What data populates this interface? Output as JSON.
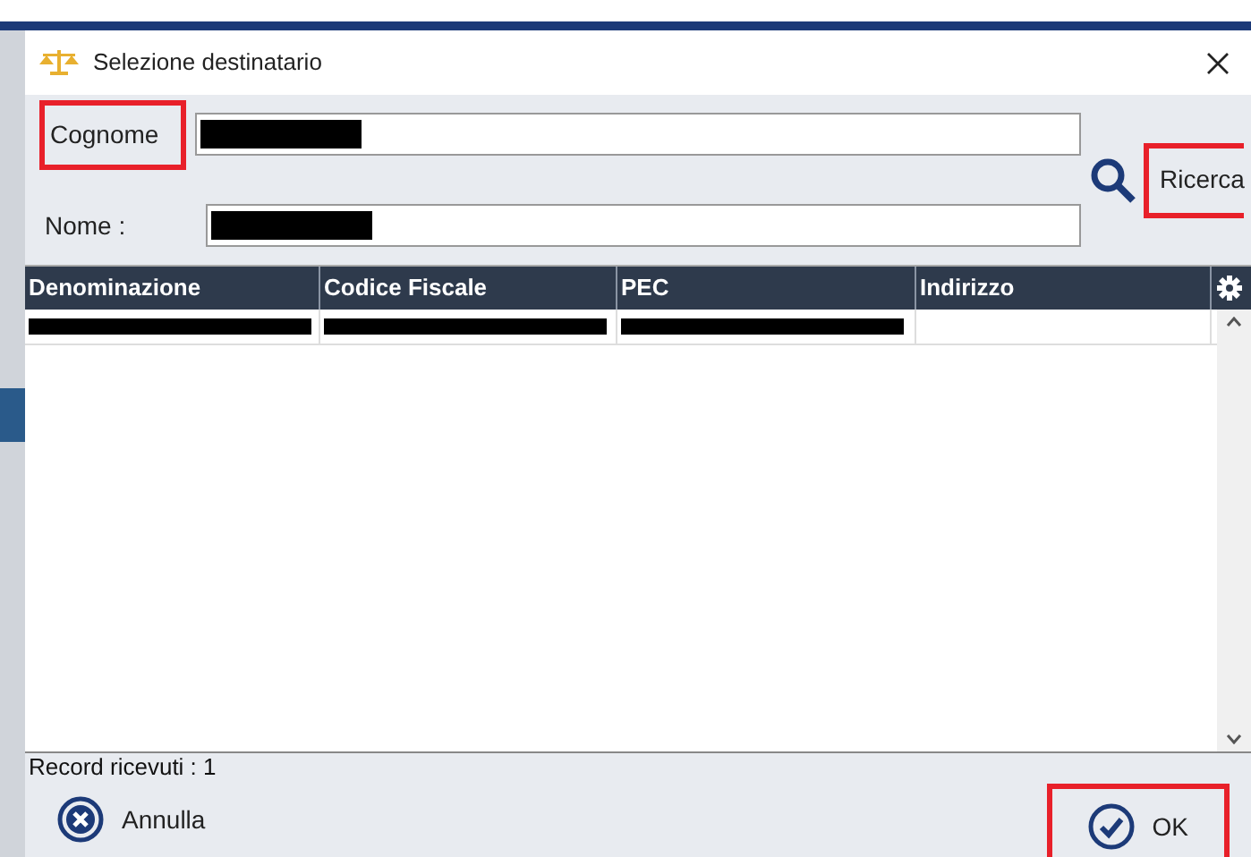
{
  "window": {
    "title": "Selezione destinatario"
  },
  "fields": [
    {
      "label": "Cognome",
      "redacted": true,
      "highlighted": true
    },
    {
      "label": "Nome :",
      "redacted": true,
      "highlighted": false
    }
  ],
  "search_button": {
    "label": "Ricerca",
    "highlighted": true
  },
  "table": {
    "columns": [
      "Denominazione",
      "Codice Fiscale",
      "PEC",
      "Indirizzo"
    ],
    "rows": [
      {
        "cells": [
          {
            "kind": "redacted"
          },
          {
            "kind": "redacted"
          },
          {
            "kind": "redacted"
          },
          {
            "kind": "empty"
          }
        ]
      }
    ]
  },
  "status": "Record ricevuti : 1",
  "buttons": [
    {
      "kind": "cancel",
      "label": "Annulla",
      "highlighted": false
    },
    {
      "kind": "ok",
      "label": "OK",
      "highlighted": true
    }
  ]
}
